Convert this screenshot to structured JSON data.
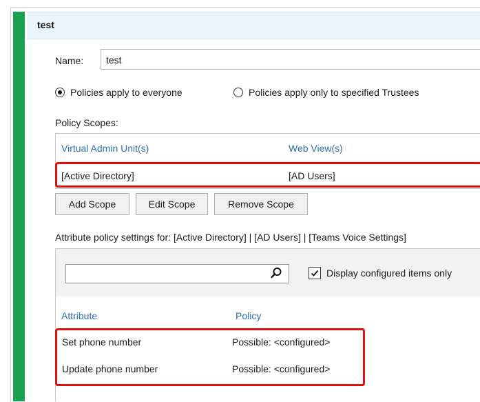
{
  "header": {
    "title": "test"
  },
  "name": {
    "label": "Name:",
    "value": "test"
  },
  "radios": [
    {
      "label": "Policies apply to everyone",
      "checked": true
    },
    {
      "label": "Policies apply only to specified Trustees",
      "checked": false
    }
  ],
  "scopes": {
    "label": "Policy Scopes:",
    "columns": [
      "Virtual Admin Unit(s)",
      "Web View(s)"
    ],
    "rows": [
      [
        "[Active Directory]",
        "[AD Users]"
      ]
    ],
    "buttons": {
      "add": "Add Scope",
      "edit": "Edit Scope",
      "remove": "Remove Scope"
    }
  },
  "attributes": {
    "label": "Attribute policy settings for: [Active Directory] | [AD Users] | [Teams Voice Settings]",
    "search": {
      "value": "",
      "placeholder": ""
    },
    "display_configured": {
      "label": "Display configured items only",
      "checked": true
    },
    "columns": [
      "Attribute",
      "Policy"
    ],
    "rows": [
      [
        "Set phone number",
        "Possible: <configured>"
      ],
      [
        "Update phone number",
        "Possible: <configured>"
      ]
    ]
  },
  "colors": {
    "accent_green": "#1aa150",
    "header_bg": "#e9f4fd",
    "link_blue": "#2e6fb5",
    "highlight_red": "#e01010"
  },
  "icons": {
    "search": "search-icon",
    "check": "check-icon"
  }
}
